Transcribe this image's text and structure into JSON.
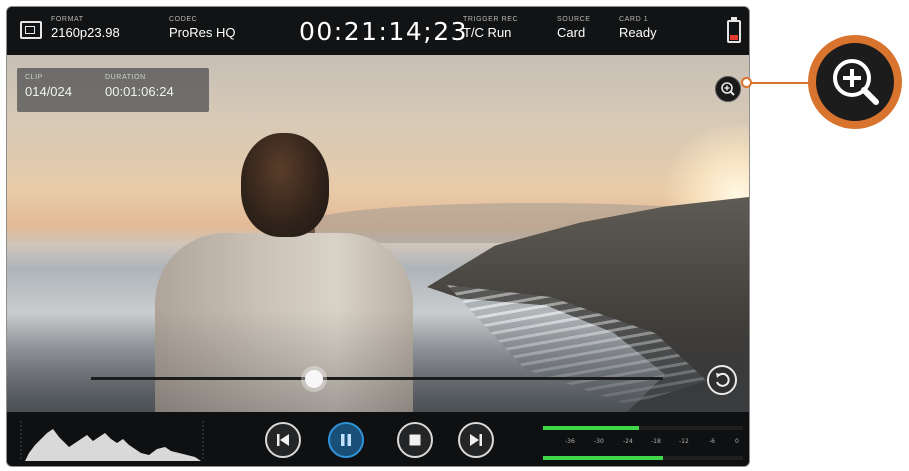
{
  "header": {
    "format": {
      "label": "FORMAT",
      "value": "2160p23.98"
    },
    "codec": {
      "label": "CODEC",
      "value": "ProRes HQ"
    },
    "timecode": "00:21:14;23",
    "trigger": {
      "label": "TRIGGER REC",
      "value": "T/C Run"
    },
    "source": {
      "label": "SOURCE",
      "value": "Card"
    },
    "card": {
      "label": "CARD 1",
      "value": "Ready"
    }
  },
  "clip_info": {
    "clip": {
      "label": "CLIP",
      "value": "014/024"
    },
    "duration": {
      "label": "DURATION",
      "value": "00:01:06:24"
    }
  },
  "playback": {
    "scrub_position": 0.39,
    "buttons": [
      {
        "name": "skip-back",
        "icon": "skip-back-icon"
      },
      {
        "name": "pause",
        "icon": "pause-icon",
        "active": true
      },
      {
        "name": "stop",
        "icon": "stop-icon"
      },
      {
        "name": "skip-forward",
        "icon": "skip-forward-icon"
      }
    ]
  },
  "audio_meters": {
    "scale": [
      "-36",
      "-30",
      "-24",
      "-18",
      "-12",
      "-6",
      "0"
    ],
    "channel_levels": [
      0.48,
      0.6
    ]
  },
  "colors": {
    "accent": "#2f93d8",
    "callout": "#d9742f",
    "meter": "#3fd64a",
    "battery_low": "#e53a2c"
  },
  "icons": {
    "zoom": "zoom-in-icon",
    "loop": "loop-icon",
    "battery": "battery-icon",
    "screen": "screen-icon"
  }
}
